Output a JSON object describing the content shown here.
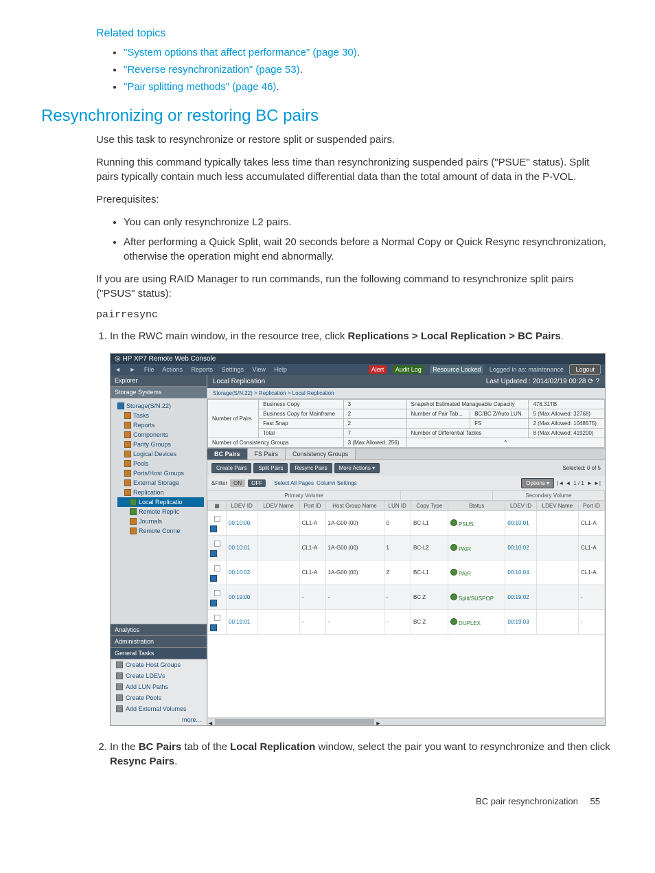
{
  "related": {
    "heading": "Related topics",
    "items": [
      "\"System options that affect performance\" (page 30)",
      "\"Reverse resynchronization\" (page 53)",
      "\"Pair splitting methods\" (page 46)"
    ]
  },
  "section_heading": "Resynchronizing or restoring BC pairs",
  "para1": "Use this task to resynchronize or restore split or suspended pairs.",
  "para2": "Running this command typically takes less time than resynchronizing suspended pairs (\"PSUE\" status). Split pairs typically contain much less accumulated differential data than the total amount of data in the P-VOL.",
  "prereq_label": "Prerequisites:",
  "prereqs": [
    "You can only resynchronize L2 pairs.",
    "After performing a Quick Split, wait 20 seconds before a Normal Copy or Quick Resync resynchronization, otherwise the operation might end abnormally."
  ],
  "para3": "If you are using RAID Manager to run commands, run the following command to resynchronize split pairs (\"PSUS\" status):",
  "cmd": "pairresync",
  "step1_a": "In the RWC main window, in the resource tree, click ",
  "step1_b": "Replications > Local Replication > BC Pairs",
  "step1_c": ".",
  "step2_a": "In the ",
  "step2_b": "BC Pairs",
  "step2_c": " tab of the ",
  "step2_d": "Local Replication",
  "step2_e": " window, select the pair you want to resynchronize and then click ",
  "step2_f": "Resync Pairs",
  "step2_g": ".",
  "footer": {
    "title": "BC pair resynchronization",
    "page": "55"
  },
  "ss": {
    "titlebar": "HP XP7 Remote Web Console",
    "menu_left": [
      "File",
      "Actions",
      "Reports",
      "Settings",
      "View",
      "Help"
    ],
    "menu_badges": [
      "Alert",
      "Audit Log",
      "Resource Locked"
    ],
    "menu_status": "Logged in as: maintenance",
    "logout": "Logout",
    "explorer": "Explorer",
    "storage_systems": "Storage Systems",
    "tree": {
      "root": "Storage(S/N:22)",
      "items": [
        "Tasks",
        "Reports",
        "Components",
        "Parity Groups",
        "Logical Devices",
        "Pools",
        "Ports/Host Groups",
        "External Storage",
        "Replication"
      ],
      "rep_children": [
        "Local Replicatio",
        "Remote Replic",
        "Journals",
        "Remote Conne"
      ]
    },
    "analytics": "Analytics",
    "admin": "Administration",
    "gen_tasks": "General Tasks",
    "tasks": [
      "Create Host Groups",
      "Create LDEVs",
      "Add LUN Paths",
      "Create Pools",
      "Add External Volumes"
    ],
    "more": "more...",
    "main_title": "Local Replication",
    "last_updated": "Last Updated : 2014/02/19 00:28",
    "breadcrumb": "Storage(S/N:22) > Replication > Local Replication",
    "stats_left": [
      [
        "Number of Pairs",
        "Business Copy",
        "3"
      ],
      [
        "",
        "Business Copy for Mainframe",
        "2"
      ],
      [
        "",
        "Fast Snap",
        "2"
      ],
      [
        "",
        "Total",
        "7"
      ],
      [
        "Number of Consistency Groups",
        "",
        "3 (Max Allowed: 256)"
      ]
    ],
    "stats_right": [
      [
        "Snapshot Estimated Manageable Capacity",
        "",
        "478.31TB"
      ],
      [
        "Number of Pair Tab...",
        "BC/BC Z/Auto LUN",
        "5 (Max Allowed: 32768)"
      ],
      [
        "",
        "FS",
        "2 (Max Allowed: 1048575)"
      ],
      [
        "Number of Differential Tables",
        "",
        "8 (Max Allowed: 419200)"
      ]
    ],
    "tabs": [
      "BC Pairs",
      "FS Pairs",
      "Consistency Groups"
    ],
    "buttons": [
      "Create Pairs",
      "Split Pairs",
      "Resync Pairs",
      "More Actions"
    ],
    "selected": "Selected: 0  of  5",
    "filter": {
      "lbl": "&Filter",
      "on": "ON",
      "off": "OFF",
      "sel": "Select All Pages",
      "col": "Column Settings"
    },
    "options": "Options",
    "page_info": "1   / 1",
    "col_groups": [
      "Primary Volume",
      "",
      "",
      "Secondary Volume"
    ],
    "col_gap": [
      "Copy Type",
      "Status"
    ],
    "cols": [
      "LDEV ID",
      "LDEV Name",
      "Port ID",
      "Host Group Name",
      "LUN ID",
      "Copy Type",
      "Status",
      "LDEV ID",
      "LDEV Name",
      "Port ID"
    ],
    "rows": [
      [
        "00:10:00",
        "",
        "CL1-A",
        "1A-G00 (00)",
        "0",
        "BC-L1",
        "PSUS",
        "00:10:01",
        "",
        "CL1-A"
      ],
      [
        "00:10:01",
        "",
        "CL1-A",
        "1A-G00 (00)",
        "1",
        "BC-L2",
        "PAIR",
        "00:10:02",
        "",
        "CL1-A"
      ],
      [
        "00:10:02",
        "",
        "CL1-A",
        "1A-G00 (00)",
        "2",
        "BC-L1",
        "PAIR",
        "00:10:04",
        "",
        "CL1-A"
      ],
      [
        "00:19:00",
        "",
        "-",
        "-",
        "-",
        "BC Z",
        "Split/SUSPOP",
        "00:19:02",
        "",
        "-"
      ],
      [
        "00:19:01",
        "",
        "-",
        "-",
        "-",
        "BC Z",
        "DUPLEX",
        "00:19:03",
        "",
        "-"
      ]
    ]
  }
}
